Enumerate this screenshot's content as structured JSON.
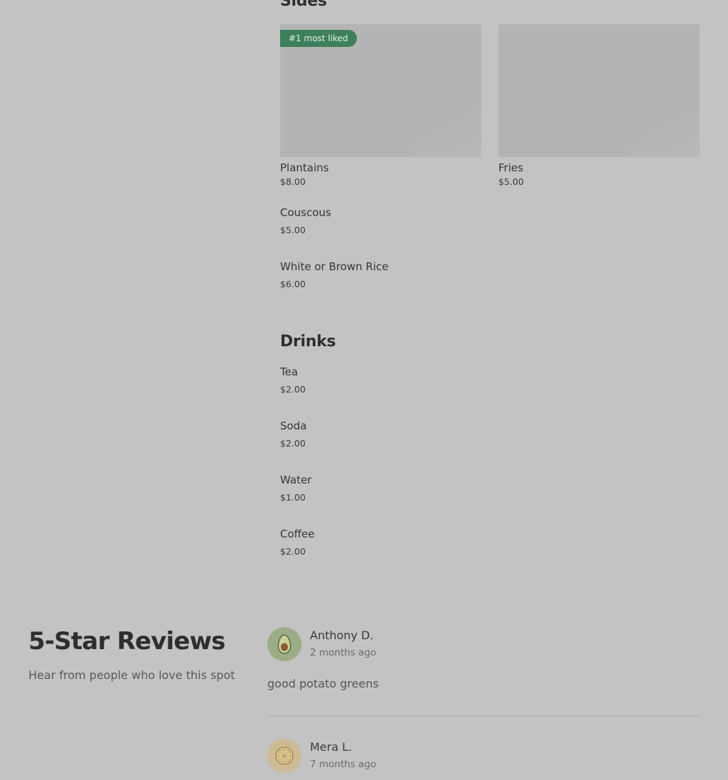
{
  "menu": {
    "sides": {
      "title": "Sides",
      "featured": [
        {
          "name": "Plantains",
          "price": "$8.00",
          "badge": "#1 most liked"
        },
        {
          "name": "Fries",
          "price": "$5.00"
        }
      ],
      "items": [
        {
          "name": "Couscous",
          "price": "$5.00"
        },
        {
          "name": "White or Brown Rice",
          "price": "$6.00"
        }
      ]
    },
    "drinks": {
      "title": "Drinks",
      "items": [
        {
          "name": "Tea",
          "price": "$2.00"
        },
        {
          "name": "Soda",
          "price": "$2.00"
        },
        {
          "name": "Water",
          "price": "$1.00"
        },
        {
          "name": "Coffee",
          "price": "$2.00"
        }
      ]
    }
  },
  "reviews": {
    "title": "5-Star Reviews",
    "subtitle": "Hear from people who love this spot",
    "list": [
      {
        "name": "Anthony D.",
        "time": "2 months ago",
        "text": "good potato greens",
        "avatar_icon": "avocado-icon",
        "avatar_color": "#9cac86"
      },
      {
        "name": "Mera L.",
        "time": "7 months ago",
        "text": "",
        "avatar_icon": "citrus-slice-icon",
        "avatar_color": "#cdbb95"
      }
    ]
  },
  "colors": {
    "page_background": "#c3c3c3",
    "badge_background": "#3e7f5c"
  }
}
